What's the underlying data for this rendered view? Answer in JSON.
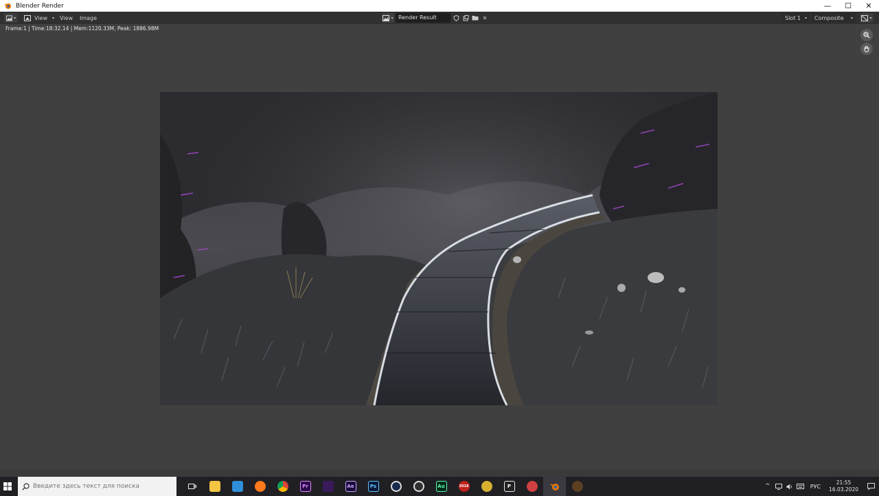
{
  "window": {
    "title": "Blender Render",
    "controls": [
      "—",
      "☐",
      "✕"
    ]
  },
  "header": {
    "menus": [
      "View",
      "View",
      "Image"
    ],
    "image_name": "Render Result",
    "slot": "Slot 1",
    "layer": "Composite"
  },
  "viewport": {
    "stats": "Frame:1 | Time:18:32.14 | Mem:1120.33M, Peak: 1886.98M"
  },
  "taskbar": {
    "search_placeholder": "Введите здесь текст для поиска",
    "apps": [
      {
        "name": "task-view",
        "label": ""
      },
      {
        "name": "file-explorer",
        "label": ""
      },
      {
        "name": "photos",
        "label": ""
      },
      {
        "name": "firefox",
        "label": ""
      },
      {
        "name": "chrome",
        "label": ""
      },
      {
        "name": "premiere-pro",
        "label": "Pr"
      },
      {
        "name": "substance",
        "label": ""
      },
      {
        "name": "after-effects",
        "label": "Ae"
      },
      {
        "name": "photoshop",
        "label": "Ps"
      },
      {
        "name": "cinema4d",
        "label": ""
      },
      {
        "name": "obs",
        "label": ""
      },
      {
        "name": "audition",
        "label": "Au"
      },
      {
        "name": "solidworks",
        "label": "2018"
      },
      {
        "name": "app-globe",
        "label": ""
      },
      {
        "name": "picsart",
        "label": "P"
      },
      {
        "name": "app-car",
        "label": ""
      },
      {
        "name": "blender",
        "label": ""
      },
      {
        "name": "app-misc",
        "label": ""
      }
    ],
    "language": "РУС",
    "time": "21:55",
    "date": "16.03.2020"
  },
  "colors": {
    "viewport_bg": "#404040",
    "header_bg": "#303030",
    "taskbar_bg": "#1f1f24",
    "accent_blender": "#ea7600"
  }
}
